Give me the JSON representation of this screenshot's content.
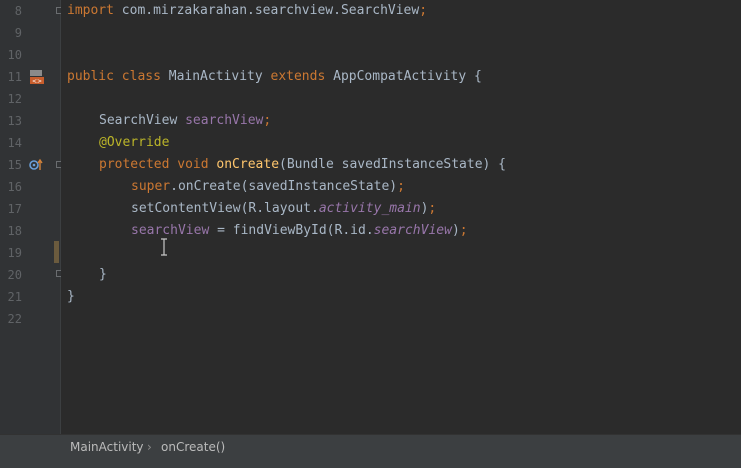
{
  "editor": {
    "line_numbers": [
      "8",
      "9",
      "10",
      "11",
      "12",
      "13",
      "14",
      "15",
      "16",
      "17",
      "18",
      "19",
      "20",
      "21",
      "22"
    ],
    "code": {
      "l8": {
        "kw": "import",
        "rest": " com.mirzakarahan.searchview.SearchView",
        "semi": ";"
      },
      "l11": {
        "kw1": "public class",
        "name": " MainActivity ",
        "kw2": "extends",
        "rest": " AppCompatActivity {"
      },
      "l13": {
        "type": "SearchView ",
        "field": "searchView",
        "semi": ";"
      },
      "l14": {
        "ann": "@Override"
      },
      "l15": {
        "kw": "protected void ",
        "fn": "onCreate",
        "rest": "(Bundle savedInstanceState) {"
      },
      "l16": {
        "kw": "super",
        "rest": ".onCreate(savedInstanceState)",
        "semi": ";"
      },
      "l17": {
        "pre": "setContentView(R.layout.",
        "field": "activity_main",
        "post": ")",
        "semi": ";"
      },
      "l18": {
        "field1": "searchView",
        "mid": " = findViewById(R.id.",
        "field2": "searchView",
        "post": ")",
        "semi": ";"
      },
      "l20": {
        "text": "}"
      },
      "l21": {
        "text": "}"
      }
    },
    "gutter_icons": {
      "l11": "class-override-icon",
      "l15": "override-method-icon"
    }
  },
  "breadcrumb": {
    "items": [
      "MainActivity",
      "onCreate()"
    ],
    "separator": "›"
  },
  "colors": {
    "background": "#2b2b2b",
    "keyword": "#cc7832",
    "function": "#ffc66d",
    "field": "#9876aa",
    "annotation": "#bbb529",
    "text": "#a9b7c6"
  }
}
